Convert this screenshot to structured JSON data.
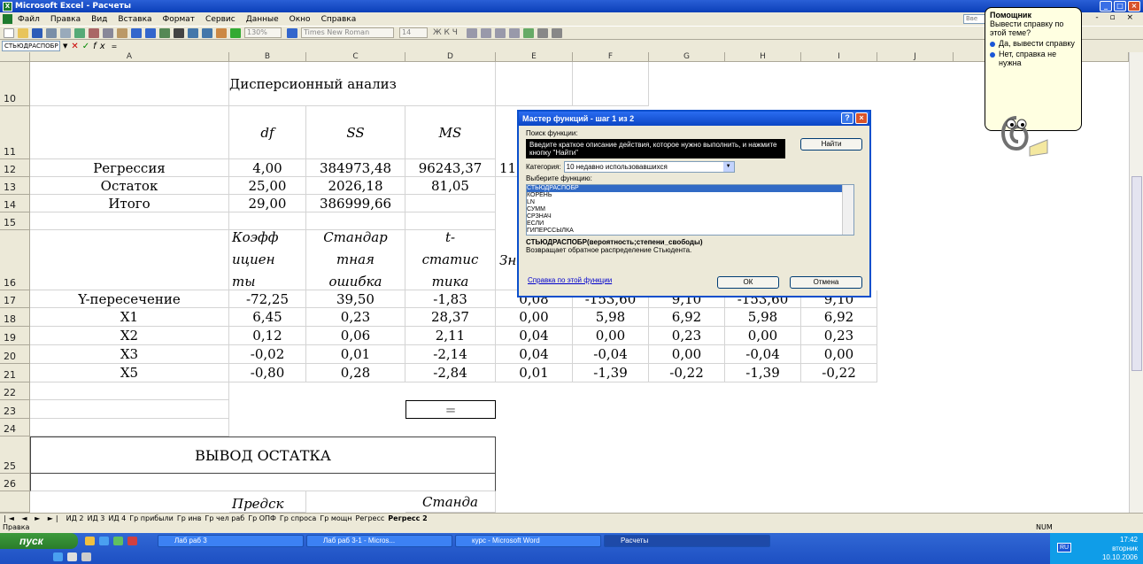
{
  "title": "Microsoft Excel - Расчеты",
  "menu": [
    "Файл",
    "Правка",
    "Вид",
    "Вставка",
    "Формат",
    "Сервис",
    "Данные",
    "Окно",
    "Справка"
  ],
  "menu_help_box": "Вве",
  "toolbar": {
    "zoom": "130%",
    "font": "Times New Roman",
    "font_size": "14",
    "letters": "Ж К Ч"
  },
  "formula": {
    "namebox": "СТЬЮДРАСПОБР",
    "formula_text": "="
  },
  "columns": [
    "A",
    "B",
    "C",
    "D",
    "E",
    "F",
    "G",
    "H",
    "I",
    "J",
    "K"
  ],
  "rows": {
    "r10": {
      "num": "10",
      "B": "Дисперсионный анализ"
    },
    "r11": {
      "num": "11",
      "B": "df",
      "C": "SS",
      "D": "MS"
    },
    "r12": {
      "num": "12",
      "A": "Регрессия",
      "B": "4,00",
      "C": "384973,48",
      "D": "96243,37",
      "E": "11"
    },
    "r13": {
      "num": "13",
      "A": "Остаток",
      "B": "25,00",
      "C": "2026,18",
      "D": "81,05"
    },
    "r14": {
      "num": "14",
      "A": "Итого",
      "B": "29,00",
      "C": "386999,66"
    },
    "r15": {
      "num": "15"
    },
    "r16": {
      "num": "16",
      "B": [
        "Коэфф",
        "ициен",
        "ты"
      ],
      "C": [
        "Стандар",
        "тная",
        "ошибка"
      ],
      "D": [
        "t-",
        "статис",
        "тика"
      ],
      "E": "Зн"
    },
    "r17": {
      "num": "17",
      "A": "Y-пересечение",
      "B": "-72,25",
      "C": "39,50",
      "D": "-1,83",
      "E": "0,08",
      "F": "-153,60",
      "G": "9,10",
      "H": "-153,60",
      "I": "9,10"
    },
    "r18": {
      "num": "18",
      "A": "X1",
      "B": "6,45",
      "C": "0,23",
      "D": "28,37",
      "E": "0,00",
      "F": "5,98",
      "G": "6,92",
      "H": "5,98",
      "I": "6,92"
    },
    "r19": {
      "num": "19",
      "A": "X2",
      "B": "0,12",
      "C": "0,06",
      "D": "2,11",
      "E": "0,04",
      "F": "0,00",
      "G": "0,23",
      "H": "0,00",
      "I": "0,23"
    },
    "r20": {
      "num": "20",
      "A": "X3",
      "B": "-0,02",
      "C": "0,01",
      "D": "-2,14",
      "E": "0,04",
      "F": "-0,04",
      "G": "0,00",
      "H": "-0,04",
      "I": "0,00"
    },
    "r21": {
      "num": "21",
      "A": "X5",
      "B": "-0,80",
      "C": "0,28",
      "D": "-2,84",
      "E": "0,01",
      "F": "-1,39",
      "G": "-0,22",
      "H": "-1,39",
      "I": "-0,22"
    },
    "r22": {
      "num": "22"
    },
    "r23": {
      "num": "23",
      "D": "="
    },
    "r24": {
      "num": "24"
    },
    "r25": {
      "num": "25",
      "A": "ВЫВОД ОСТАТКА"
    },
    "r26": {
      "num": "26"
    },
    "r27": {
      "B": "Предск",
      "D": "Станда"
    }
  },
  "dialog": {
    "title": "Мастер функций - шаг 1 из 2",
    "search_label": "Поиск функции:",
    "search_text": "Введите краткое описание действия, которое нужно выполнить, и нажмите кнопку \"Найти\"",
    "find_button": "Найти",
    "category_label": "Категория:",
    "category_value": "10 недавно использовавшихся",
    "choose_label": "Выберите функцию:",
    "functions": [
      "СТЬЮДРАСПОБР",
      "КОРЕНЬ",
      "LN",
      "СУММ",
      "СРЗНАЧ",
      "ЕСЛИ",
      "ГИПЕРССЫЛКА"
    ],
    "signature": "СТЬЮДРАСПОБР(вероятность;степени_свободы)",
    "description": "Возвращает обратное распределение Стьюдента.",
    "help_link": "Справка по этой функции",
    "ok": "ОК",
    "cancel": "Отмена"
  },
  "assistant": {
    "title": "Помощник",
    "question": "Вывести справку по этой теме?",
    "yes": "Да, вывести справку",
    "no": "Нет, справка не нужна"
  },
  "sheet_tabs": [
    "ИД 2",
    "ИД 3",
    "ИД 4",
    "Гр прибыли",
    "Гр инв",
    "Гр чел раб",
    "Гр ОПФ",
    "Гр спроса",
    "Гр мощн",
    "Регресс",
    "Регресс 2"
  ],
  "active_tab": "Регресс 2",
  "status": {
    "left": "Правка",
    "num": "NUM"
  },
  "taskbar": {
    "start": "пуск",
    "tasks": [
      "Лаб раб 3",
      "Лаб раб 3-1 - Micros...",
      "курс - Microsoft Word",
      "Расчеты"
    ],
    "lang": "RU",
    "time": "17:42",
    "day": "вторник",
    "date": "10.10.2006"
  }
}
